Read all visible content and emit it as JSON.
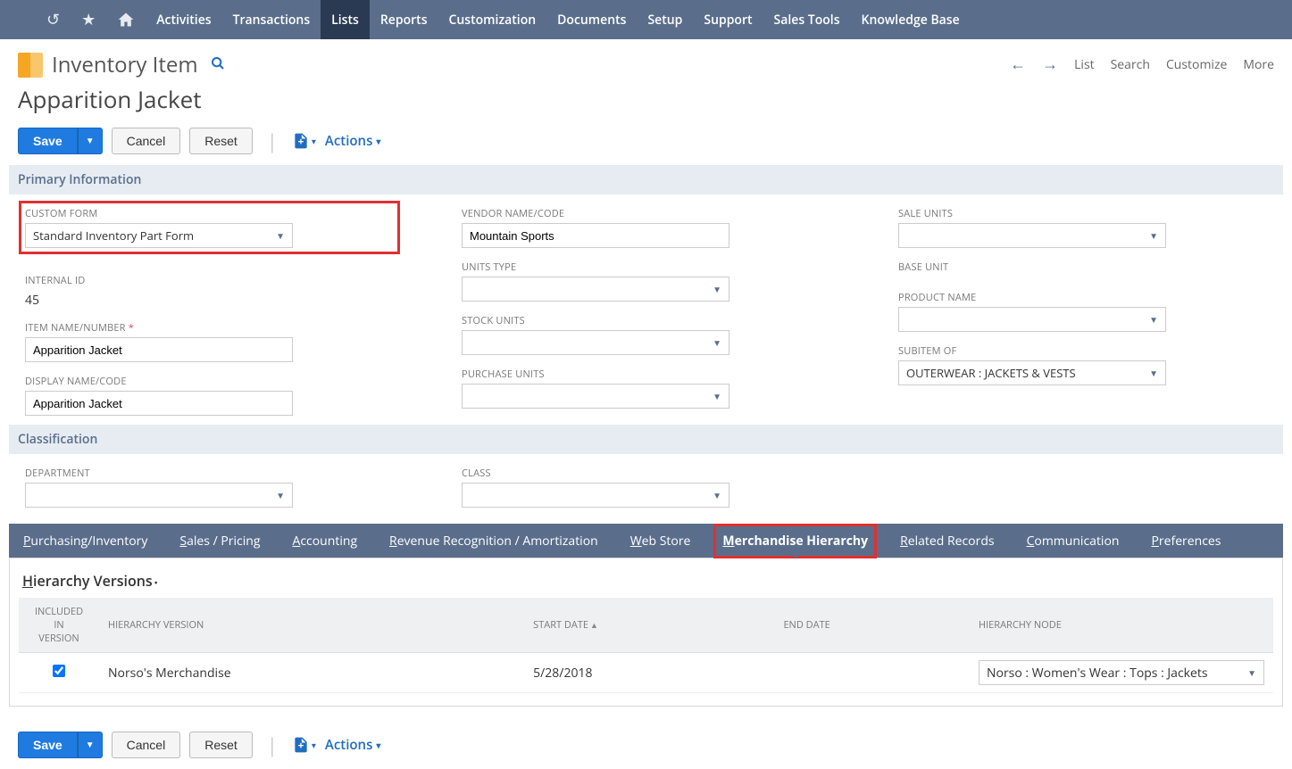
{
  "nav": {
    "items": [
      "Activities",
      "Transactions",
      "Lists",
      "Reports",
      "Customization",
      "Documents",
      "Setup",
      "Support",
      "Sales Tools",
      "Knowledge Base"
    ],
    "active_index": 2
  },
  "header": {
    "page_type": "Inventory Item",
    "record_name": "Apparition Jacket",
    "right_links": [
      "List",
      "Search",
      "Customize",
      "More"
    ]
  },
  "buttons": {
    "save": "Save",
    "cancel": "Cancel",
    "reset": "Reset",
    "actions": "Actions"
  },
  "sections": {
    "primary": "Primary Information",
    "classification": "Classification"
  },
  "fields": {
    "custom_form": {
      "label": "CUSTOM FORM",
      "value": "Standard Inventory Part Form"
    },
    "internal_id": {
      "label": "INTERNAL ID",
      "value": "45"
    },
    "item_name": {
      "label": "ITEM NAME/NUMBER",
      "value": "Apparition Jacket",
      "required": true
    },
    "display_name": {
      "label": "DISPLAY NAME/CODE",
      "value": "Apparition Jacket"
    },
    "vendor_name": {
      "label": "VENDOR NAME/CODE",
      "value": "Mountain Sports"
    },
    "units_type": {
      "label": "UNITS TYPE",
      "value": ""
    },
    "stock_units": {
      "label": "STOCK UNITS",
      "value": ""
    },
    "purchase_units": {
      "label": "PURCHASE UNITS",
      "value": ""
    },
    "sale_units": {
      "label": "SALE UNITS",
      "value": ""
    },
    "base_unit": {
      "label": "BASE UNIT",
      "value": ""
    },
    "product_name": {
      "label": "PRODUCT NAME",
      "value": ""
    },
    "subitem_of": {
      "label": "SUBITEM OF",
      "value": "OUTERWEAR : JACKETS & VESTS"
    },
    "department": {
      "label": "DEPARTMENT",
      "value": ""
    },
    "class": {
      "label": "CLASS",
      "value": ""
    }
  },
  "tabs": {
    "items": [
      {
        "label": "Purchasing/Inventory",
        "ul": "P"
      },
      {
        "label": "Sales / Pricing",
        "ul": "S"
      },
      {
        "label": "Accounting",
        "ul": "A"
      },
      {
        "label": "Revenue Recognition / Amortization",
        "ul": "R"
      },
      {
        "label": "Web Store",
        "ul": "W"
      },
      {
        "label": "Merchandise Hierarchy",
        "ul": "M"
      },
      {
        "label": "Related Records",
        "ul": "R"
      },
      {
        "label": "Communication",
        "ul": "C"
      },
      {
        "label": "Preferences",
        "ul": "P"
      }
    ],
    "active_index": 5
  },
  "subtab": {
    "title": "Hierarchy Versions",
    "title_ul": "H",
    "columns": {
      "included": "INCLUDED IN VERSION",
      "hierarchy_version": "HIERARCHY VERSION",
      "start_date": "START DATE",
      "end_date": "END DATE",
      "hierarchy_node": "HIERARCHY NODE"
    },
    "rows": [
      {
        "included": true,
        "hierarchy_version": "Norso's Merchandise",
        "start_date": "5/28/2018",
        "end_date": "",
        "hierarchy_node": "Norso : Women's Wear : Tops : Jackets"
      }
    ]
  }
}
